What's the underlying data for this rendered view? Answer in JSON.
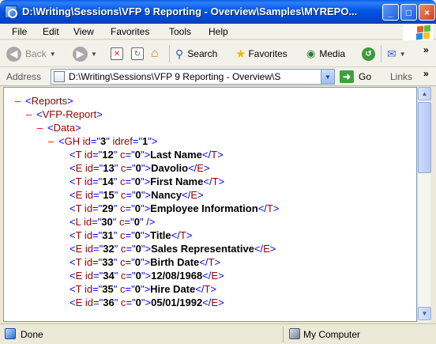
{
  "window": {
    "title": "D:\\Writing\\Sessions\\VFP 9 Reporting - Overview\\Samples\\MYREPO...",
    "minimize": "_",
    "maximize": "□",
    "close": "×"
  },
  "menu": [
    "File",
    "Edit",
    "View",
    "Favorites",
    "Tools",
    "Help"
  ],
  "toolbar": {
    "back": "Back",
    "search": "Search",
    "favorites": "Favorites",
    "media": "Media",
    "overflow": "»"
  },
  "address": {
    "label": "Address",
    "value": "D:\\Writing\\Sessions\\VFP 9 Reporting - Overview\\S",
    "go": "Go",
    "links": "Links",
    "links_overflow": "»"
  },
  "xml_lines": [
    {
      "indent": 0,
      "minus": "–",
      "open": "<",
      "tag": "Reports",
      "attrs": [],
      "close": ">",
      "text": "",
      "end_tag": ""
    },
    {
      "indent": 1,
      "minus": "–",
      "open": "<",
      "tag": "VFP-Report",
      "attrs": [],
      "close": ">",
      "text": "",
      "end_tag": ""
    },
    {
      "indent": 2,
      "minus": "–",
      "open": "<",
      "tag": "Data",
      "attrs": [],
      "close": ">",
      "text": "",
      "end_tag": ""
    },
    {
      "indent": 3,
      "minus": "–",
      "open": "<",
      "tag": "GH",
      "attrs": [
        [
          "id",
          "3"
        ],
        [
          "idref",
          "1"
        ]
      ],
      "close": ">",
      "text": "",
      "end_tag": ""
    },
    {
      "indent": 4,
      "minus": "",
      "open": "<",
      "tag": "T",
      "attrs": [
        [
          "id",
          "12"
        ],
        [
          "c",
          "0"
        ]
      ],
      "close": ">",
      "text": "Last Name",
      "end_tag": "T"
    },
    {
      "indent": 4,
      "minus": "",
      "open": "<",
      "tag": "E",
      "attrs": [
        [
          "id",
          "13"
        ],
        [
          "c",
          "0"
        ]
      ],
      "close": ">",
      "text": "Davolio",
      "end_tag": "E"
    },
    {
      "indent": 4,
      "minus": "",
      "open": "<",
      "tag": "T",
      "attrs": [
        [
          "id",
          "14"
        ],
        [
          "c",
          "0"
        ]
      ],
      "close": ">",
      "text": "First Name",
      "end_tag": "T"
    },
    {
      "indent": 4,
      "minus": "",
      "open": "<",
      "tag": "E",
      "attrs": [
        [
          "id",
          "15"
        ],
        [
          "c",
          "0"
        ]
      ],
      "close": ">",
      "text": "Nancy",
      "end_tag": "E"
    },
    {
      "indent": 4,
      "minus": "",
      "open": "<",
      "tag": "T",
      "attrs": [
        [
          "id",
          "29"
        ],
        [
          "c",
          "0"
        ]
      ],
      "close": ">",
      "text": "Employee Information",
      "end_tag": "T"
    },
    {
      "indent": 4,
      "minus": "",
      "open": "<",
      "tag": "L",
      "attrs": [
        [
          "id",
          "30"
        ],
        [
          "c",
          "0"
        ]
      ],
      "close": " />",
      "text": "",
      "end_tag": ""
    },
    {
      "indent": 4,
      "minus": "",
      "open": "<",
      "tag": "T",
      "attrs": [
        [
          "id",
          "31"
        ],
        [
          "c",
          "0"
        ]
      ],
      "close": ">",
      "text": "Title",
      "end_tag": "T"
    },
    {
      "indent": 4,
      "minus": "",
      "open": "<",
      "tag": "E",
      "attrs": [
        [
          "id",
          "32"
        ],
        [
          "c",
          "0"
        ]
      ],
      "close": ">",
      "text": "Sales Representative",
      "end_tag": "E"
    },
    {
      "indent": 4,
      "minus": "",
      "open": "<",
      "tag": "T",
      "attrs": [
        [
          "id",
          "33"
        ],
        [
          "c",
          "0"
        ]
      ],
      "close": ">",
      "text": "Birth Date",
      "end_tag": "T"
    },
    {
      "indent": 4,
      "minus": "",
      "open": "<",
      "tag": "E",
      "attrs": [
        [
          "id",
          "34"
        ],
        [
          "c",
          "0"
        ]
      ],
      "close": ">",
      "text": "12/08/1968",
      "end_tag": "E"
    },
    {
      "indent": 4,
      "minus": "",
      "open": "<",
      "tag": "T",
      "attrs": [
        [
          "id",
          "35"
        ],
        [
          "c",
          "0"
        ]
      ],
      "close": ">",
      "text": "Hire Date",
      "end_tag": "T"
    },
    {
      "indent": 4,
      "minus": "",
      "open": "<",
      "tag": "E",
      "attrs": [
        [
          "id",
          "36"
        ],
        [
          "c",
          "0"
        ]
      ],
      "close": ">",
      "text": "05/01/1992",
      "end_tag": "E"
    }
  ],
  "status": {
    "left": "Done",
    "zone": "My Computer"
  },
  "icons": {
    "title": "ie-page-icon",
    "back": "back-arrow-icon",
    "forward": "forward-arrow-icon",
    "stop": "stop-icon",
    "refresh": "refresh-icon",
    "home": "home-icon",
    "search": "search-icon",
    "favorites": "favorites-star-icon",
    "media": "media-icon",
    "history": "history-icon",
    "mail": "mail-icon"
  }
}
